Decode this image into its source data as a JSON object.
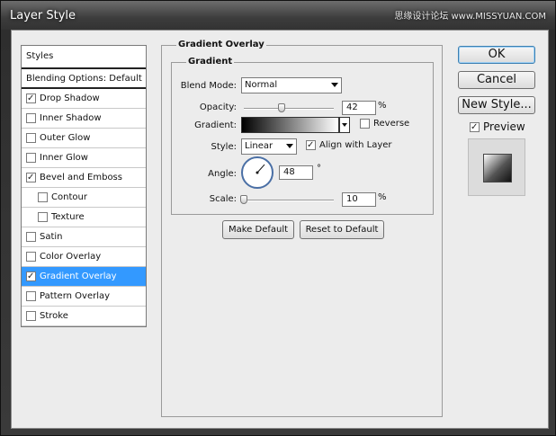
{
  "window": {
    "title": "Layer Style",
    "watermark": "思缘设计论坛 www.MISSYUAN.COM"
  },
  "styles_list": {
    "header": "Styles",
    "blending": "Blending Options: Default",
    "items": [
      {
        "label": "Drop Shadow",
        "checked": true,
        "indent": false,
        "selected": false
      },
      {
        "label": "Inner Shadow",
        "checked": false,
        "indent": false,
        "selected": false
      },
      {
        "label": "Outer Glow",
        "checked": false,
        "indent": false,
        "selected": false
      },
      {
        "label": "Inner Glow",
        "checked": false,
        "indent": false,
        "selected": false
      },
      {
        "label": "Bevel and Emboss",
        "checked": true,
        "indent": false,
        "selected": false
      },
      {
        "label": "Contour",
        "checked": false,
        "indent": true,
        "selected": false
      },
      {
        "label": "Texture",
        "checked": false,
        "indent": true,
        "selected": false
      },
      {
        "label": "Satin",
        "checked": false,
        "indent": false,
        "selected": false
      },
      {
        "label": "Color Overlay",
        "checked": false,
        "indent": false,
        "selected": false
      },
      {
        "label": "Gradient Overlay",
        "checked": true,
        "indent": false,
        "selected": true
      },
      {
        "label": "Pattern Overlay",
        "checked": false,
        "indent": false,
        "selected": false
      },
      {
        "label": "Stroke",
        "checked": false,
        "indent": false,
        "selected": false
      }
    ]
  },
  "panel": {
    "section_title": "Gradient Overlay",
    "group_title": "Gradient",
    "blend_mode": {
      "label": "Blend Mode:",
      "value": "Normal"
    },
    "opacity": {
      "label": "Opacity:",
      "value": "42",
      "unit": "%",
      "fraction": 0.42
    },
    "gradient": {
      "label": "Gradient:",
      "reverse_label": "Reverse",
      "reverse_checked": false
    },
    "style": {
      "label": "Style:",
      "value": "Linear",
      "align_label": "Align with Layer",
      "align_checked": true
    },
    "angle": {
      "label": "Angle:",
      "value": "48",
      "unit": "°",
      "degrees": 48
    },
    "scale": {
      "label": "Scale:",
      "value": "10",
      "unit": "%",
      "fraction": 0.0
    },
    "make_default": "Make Default",
    "reset_default": "Reset to Default"
  },
  "side_buttons": {
    "ok": "OK",
    "cancel": "Cancel",
    "new_style": "New Style...",
    "preview_label": "Preview",
    "preview_checked": true
  }
}
